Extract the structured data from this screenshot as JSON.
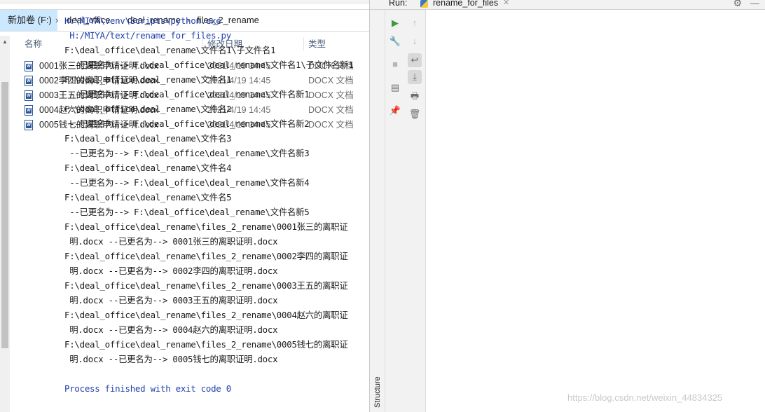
{
  "explorer": {
    "breadcrumb": [
      "新加卷 (F:)",
      "deal_office",
      "deal_rename",
      "files_2_rename"
    ],
    "columns": {
      "name": "名称",
      "date": "修改日期",
      "type": "类型"
    },
    "files": [
      {
        "name": "0001张三的离职申请证明.docx",
        "date": "2021/4/19 14:45",
        "type": "DOCX 文档"
      },
      {
        "name": "0002李四的离职申请证明.docx",
        "date": "2021/4/19 14:45",
        "type": "DOCX 文档"
      },
      {
        "name": "0003王五的离职申请证明.docx",
        "date": "2021/4/19 14:45",
        "type": "DOCX 文档"
      },
      {
        "name": "0004赵六的离职申请证明.docx",
        "date": "2021/4/19 14:45",
        "type": "DOCX 文档"
      },
      {
        "name": "0005钱七的离职申请证明.docx",
        "date": "2021/4/19 14:45",
        "type": "DOCX 文档"
      }
    ]
  },
  "ide": {
    "run_label": "Run:",
    "tab_label": "rename_for_files",
    "structure_label": "Structure",
    "console": [
      "H:\\MIYA\\venv\\Scripts\\python.exe",
      " H:/MIYA/text/rename_for_files.py",
      "F:\\deal_office\\deal_rename\\文件名1\\子文件名1",
      " --已更名为--> F:\\deal_office\\deal_rename\\文件名1\\子文件名新1",
      "F:\\deal_office\\deal_rename\\文件名1",
      " --已更名为--> F:\\deal_office\\deal_rename\\文件名新1",
      "F:\\deal_office\\deal_rename\\文件名2",
      " --已更名为--> F:\\deal_office\\deal_rename\\文件名新2",
      "F:\\deal_office\\deal_rename\\文件名3",
      " --已更名为--> F:\\deal_office\\deal_rename\\文件名新3",
      "F:\\deal_office\\deal_rename\\文件名4",
      " --已更名为--> F:\\deal_office\\deal_rename\\文件名新4",
      "F:\\deal_office\\deal_rename\\文件名5",
      " --已更名为--> F:\\deal_office\\deal_rename\\文件名新5",
      "F:\\deal_office\\deal_rename\\files_2_rename\\0001张三的离职证",
      " 明.docx --已更名为--> 0001张三的离职证明.docx",
      "F:\\deal_office\\deal_rename\\files_2_rename\\0002李四的离职证",
      " 明.docx --已更名为--> 0002李四的离职证明.docx",
      "F:\\deal_office\\deal_rename\\files_2_rename\\0003王五的离职证",
      " 明.docx --已更名为--> 0003王五的离职证明.docx",
      "F:\\deal_office\\deal_rename\\files_2_rename\\0004赵六的离职证",
      " 明.docx --已更名为--> 0004赵六的离职证明.docx",
      "F:\\deal_office\\deal_rename\\files_2_rename\\0005钱七的离职证",
      " 明.docx --已更名为--> 0005钱七的离职证明.docx",
      "",
      "Process finished with exit code 0"
    ]
  },
  "watermark": "https://blog.csdn.net/weixin_44834325",
  "colors": {
    "console_path_blue": "#1f3fad",
    "breadcrumb_highlight": "#cce8ff",
    "run_green": "#3a9c3a"
  }
}
